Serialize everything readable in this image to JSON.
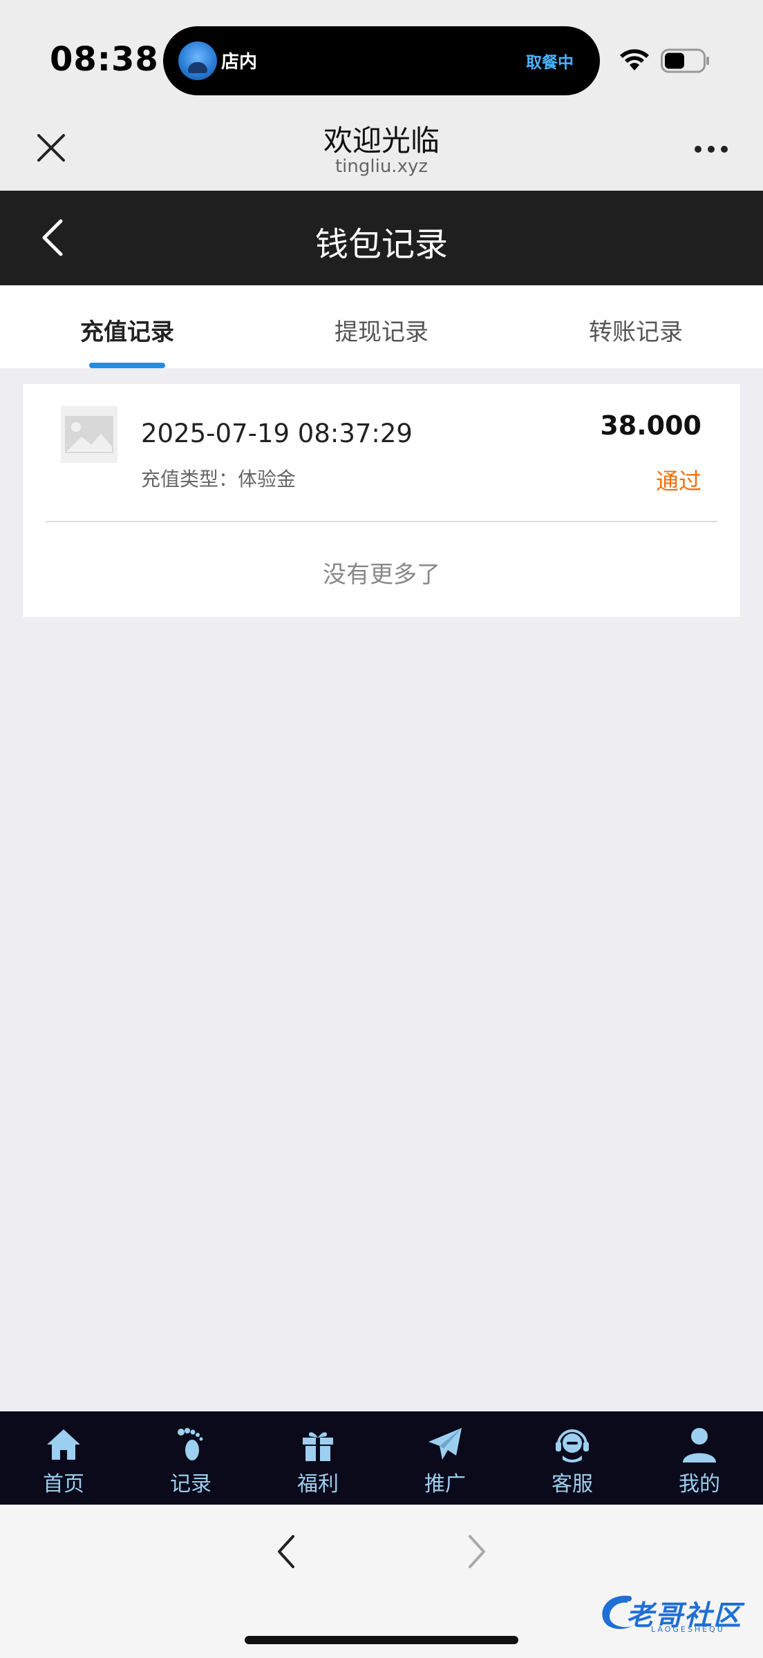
{
  "status_bar": {
    "time": "08:38",
    "island_left": "店内",
    "island_right": "取餐中"
  },
  "browser": {
    "title": "欢迎光临",
    "domain": "tingliu.xyz"
  },
  "app_header": {
    "title": "钱包记录"
  },
  "tabs": [
    {
      "label": "充值记录",
      "active": true
    },
    {
      "label": "提现记录",
      "active": false
    },
    {
      "label": "转账记录",
      "active": false
    }
  ],
  "records": [
    {
      "time": "2025-07-19 08:37:29",
      "type_label": "充值类型：体验金",
      "amount": "38.000",
      "status": "通过"
    }
  ],
  "no_more_text": "没有更多了",
  "bottom_nav": [
    {
      "label": "首页",
      "icon": "home-icon"
    },
    {
      "label": "记录",
      "icon": "footprint-icon"
    },
    {
      "label": "福利",
      "icon": "gift-icon"
    },
    {
      "label": "推广",
      "icon": "paper-plane-icon"
    },
    {
      "label": "客服",
      "icon": "headset-icon"
    },
    {
      "label": "我的",
      "icon": "user-icon"
    }
  ],
  "watermark": {
    "text": "老哥社区",
    "sub": "LAOGESHEQU"
  },
  "colors": {
    "accent_blue": "#1e8fe8",
    "status_orange": "#f07010",
    "nav_bg": "#0a0a1a",
    "nav_label": "#9ccff0",
    "header_dark": "#1f1f1f"
  }
}
